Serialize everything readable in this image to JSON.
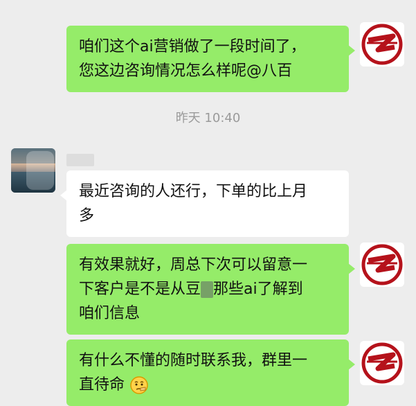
{
  "messages": [
    {
      "sender": "me",
      "text": "咱们这个ai营销做了一段时间了，\n您这边咨询情况怎么样呢@八百"
    },
    {
      "timestamp": "昨天 10:40"
    },
    {
      "sender": "other",
      "text": "最近咨询的人还行，下单的比上月\n多"
    },
    {
      "sender": "me",
      "text_before_censor": "有效果就好，周总下次可以留意一\n下客户是不是从豆",
      "text_after_censor": "那些ai了解到\n咱们信息"
    },
    {
      "sender": "me",
      "text": "有什么不懂的随时联系我，群里一\n直待命",
      "emoji": "thinking-face-emoji"
    }
  ],
  "colors": {
    "background": "#ededed",
    "my_bubble": "#95ec69",
    "other_bubble": "#ffffff",
    "timestamp_text": "#9a9a9a",
    "logo_red": "#b5121b"
  },
  "icons": {
    "my_avatar": "red-circle-z-logo",
    "other_avatar": "sunset-lake-photo"
  }
}
